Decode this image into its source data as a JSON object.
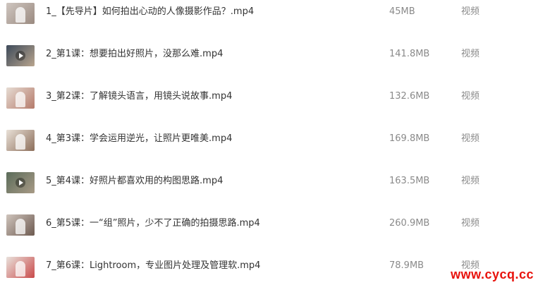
{
  "files": [
    {
      "name": "1_【先导片】如何拍出心动的人像摄影作品？.mp4",
      "size": "45MB",
      "type": "视频",
      "thumb_colors": [
        "#cfc6c0",
        "#9a8a80"
      ]
    },
    {
      "name": "2_第1课：想要拍出好照片，没那么难.mp4",
      "size": "141.8MB",
      "type": "视频",
      "thumb_colors": [
        "#3d4a5a",
        "#b9a58e"
      ]
    },
    {
      "name": "3_第2课：了解镜头语言，用镜头说故事.mp4",
      "size": "132.6MB",
      "type": "视频",
      "thumb_colors": [
        "#e6dcd3",
        "#b57a6a"
      ]
    },
    {
      "name": "4_第3课：学会运用逆光，让照片更唯美.mp4",
      "size": "169.8MB",
      "type": "视频",
      "thumb_colors": [
        "#e9e1d8",
        "#8c6e5a"
      ]
    },
    {
      "name": "5_第4课：好照片都喜欢用的构图思路.mp4",
      "size": "163.5MB",
      "type": "视频",
      "thumb_colors": [
        "#5b6c5a",
        "#a89a86"
      ]
    },
    {
      "name": "6_第5课：一“组”照片，少不了正确的拍摄思路.mp4",
      "size": "260.9MB",
      "type": "视频",
      "thumb_colors": [
        "#cfc4bc",
        "#6d5a50"
      ]
    },
    {
      "name": "7_第6课：Lightroom，专业图片处理及管理软.mp4",
      "size": "78.9MB",
      "type": "视频",
      "thumb_colors": [
        "#e9e2dc",
        "#c94a4a"
      ]
    }
  ],
  "watermark": "www.cycq.cc",
  "colors": {
    "name_text": "#333333",
    "meta_text": "#8a8a8a",
    "watermark": "#e8120c"
  },
  "icons": {
    "play": "play-icon"
  }
}
